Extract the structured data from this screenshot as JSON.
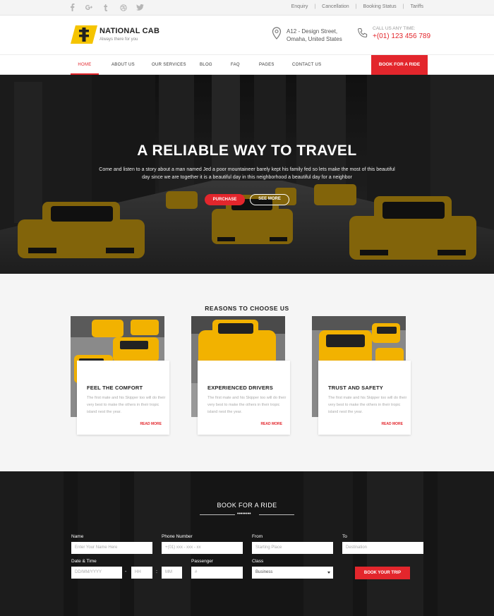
{
  "topbar": {
    "social_icons": [
      "facebook-icon",
      "google-plus-icon",
      "tumblr-icon",
      "dribbble-icon",
      "twitter-icon"
    ],
    "links": [
      "Enquiry",
      "Cancellation",
      "Booking Status",
      "Tariffs"
    ]
  },
  "header": {
    "brand": "NATIONAL CAB",
    "tagline": "Always there for you",
    "address_line1": "A12 - Design Street,",
    "address_line2": "Omaha, United States",
    "call_label": "CALL US ANY TIME:",
    "phone": "+(01) 123 456 789"
  },
  "nav": {
    "items": [
      "HOME",
      "ABOUT US",
      "OUR SERVICES",
      "BLOG",
      "FAQ",
      "PAGES",
      "CONTACT US"
    ],
    "active": "HOME",
    "book_button": "BOOK FOR A RIDE"
  },
  "hero": {
    "title": "A RELIABLE WAY TO TRAVEL",
    "text": "Come and listen to a story about a man named Jed a poor mountaineer barely kept his family fed so lets make the most of this beautiful day since we are together it is a beautiful day in this neighborhood a beautiful day for a neighbor",
    "purchase_button": "PURCHASE",
    "see_more_button": "SEE MORE"
  },
  "reasons": {
    "title": "REASONS TO CHOOSE US",
    "cards": [
      {
        "title": "FEEL THE COMFORT",
        "text": "The first mate and his Skipper too will do their very best to make the others in their tropic island nest the year.",
        "link": "READ MORE"
      },
      {
        "title": "EXPERIENCED DRIVERS",
        "text": "The first mate and his Skipper too will do their very best to make the others in their tropic island nest the year.",
        "link": "READ MORE"
      },
      {
        "title": "TRUST AND SAFETY",
        "text": "The first mate and his Skipper too will do their very best to make the others in their tropic island nest the year.",
        "link": "READ MORE"
      }
    ]
  },
  "booking": {
    "title": "BOOK FOR A RIDE",
    "divider_dots": "••••••••",
    "name_label": "Name",
    "name_placeholder": "Enter Your Name Here",
    "phone_label": "Phone Number",
    "phone_placeholder": "+(01) xxx - xxx - xx",
    "from_label": "From",
    "from_placeholder": "Starting Place",
    "to_label": "To",
    "to_placeholder": "Destination",
    "datetime_label": "Date & Time",
    "date_placeholder": "DD/MM/YYYY",
    "date_sep": "-",
    "hour_placeholder": "HH",
    "time_sep": ":",
    "minute_placeholder": "MM",
    "passenger_label": "Passenger",
    "passenger_placeholder": "#",
    "class_label": "Class",
    "class_value": "Business",
    "submit": "BOOK YOUR TRIP"
  },
  "colors": {
    "accent": "#e3262c",
    "taxi_yellow": "#f5b800"
  }
}
